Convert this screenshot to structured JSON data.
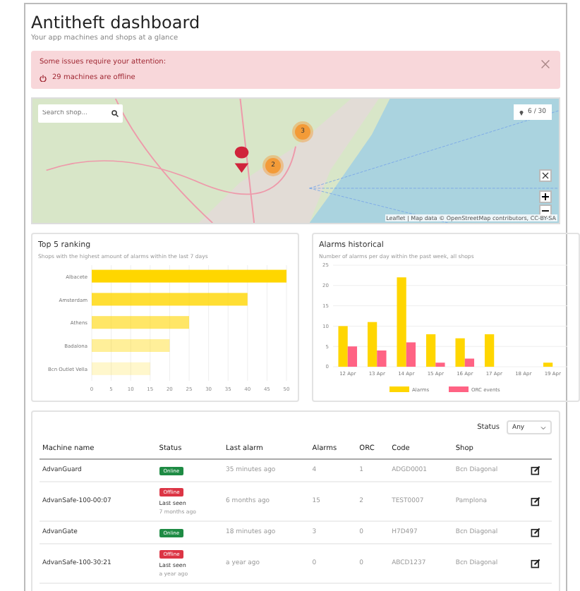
{
  "header": {
    "title": "Antitheft dashboard",
    "subtitle": "Your app machines and shops at a glance"
  },
  "alert": {
    "title": "Some issues require your attention:",
    "items": [
      "29 machines are offline"
    ],
    "dismissible": true
  },
  "map": {
    "search": {
      "placeholder": "Search shop..."
    },
    "counter": "6 / 30",
    "clusters": [
      {
        "count": "3"
      },
      {
        "count": "2"
      }
    ],
    "attribution": "Leaflet | Map data © OpenStreetMap contributors, CC-BY-SA",
    "zoom_in": "+",
    "zoom_out": "−"
  },
  "ranking": {
    "title": "Top 5 ranking",
    "subtitle": "Shops with the highest amount of alarms within the last 7 days",
    "chart_data": {
      "type": "bar",
      "orientation": "horizontal",
      "categories": [
        "Albacete",
        "Amsterdam",
        "Athens",
        "Badalona",
        "Bcn Outlet Vella"
      ],
      "series": [
        {
          "color": "#ffd600",
          "values": [
            50,
            40,
            25,
            20,
            15
          ]
        }
      ],
      "grid": true,
      "xlim": [
        0,
        50
      ],
      "xticks": [
        0,
        5,
        10,
        15,
        20,
        25,
        30,
        35,
        40,
        45,
        50
      ]
    }
  },
  "historical": {
    "title": "Alarms historical",
    "subtitle": "Number of alarms per day within the past week, all shops",
    "chart_data": {
      "type": "bar",
      "categories": [
        "12 Apr",
        "13 Apr",
        "14 Apr",
        "15 Apr",
        "16 Apr",
        "17 Apr",
        "18 Apr",
        "19 Apr"
      ],
      "series": [
        {
          "name": "Alarms",
          "color": "#ffd600",
          "values": [
            10,
            11,
            22,
            8,
            7,
            8,
            0,
            1
          ]
        },
        {
          "name": "ORC events",
          "color": "#ff6384",
          "values": [
            5,
            4,
            6,
            1,
            2,
            0,
            0,
            0
          ]
        }
      ],
      "grid": true,
      "legend": true,
      "ylim": [
        0,
        25
      ],
      "yticks": [
        0,
        5,
        10,
        15,
        20,
        25
      ]
    }
  },
  "table": {
    "filter": {
      "label": "Status",
      "value": "Any"
    },
    "columns": [
      "Machine name",
      "Status",
      "Last alarm",
      "Alarms",
      "ORC",
      "Code",
      "Shop"
    ],
    "rows": [
      {
        "name": "AdvanGuard",
        "status": {
          "kind": "online",
          "label": "Online"
        },
        "last_alarm": "35 minutes ago",
        "alarms": "4",
        "orc": "1",
        "code": "ADGD0001",
        "shop": "Bcn Diagonal"
      },
      {
        "name": "AdvanSafe-100-00:07",
        "status": {
          "kind": "offline",
          "label": "Offline",
          "seen_label": "Last seen",
          "seen": "7 months ago"
        },
        "last_alarm": "6 months ago",
        "alarms": "15",
        "orc": "2",
        "code": "TEST0007",
        "shop": "Pamplona"
      },
      {
        "name": "AdvanGate",
        "status": {
          "kind": "online",
          "label": "Online"
        },
        "last_alarm": "18 minutes ago",
        "alarms": "3",
        "orc": "0",
        "code": "H7D497",
        "shop": "Bcn Diagonal"
      },
      {
        "name": "AdvanSafe-100-30:21",
        "status": {
          "kind": "offline",
          "label": "Offline",
          "seen_label": "Last seen",
          "seen": "a year ago"
        },
        "last_alarm": "a year ago",
        "alarms": "0",
        "orc": "0",
        "code": "ABCD1237",
        "shop": "Bcn Diagonal"
      }
    ]
  }
}
